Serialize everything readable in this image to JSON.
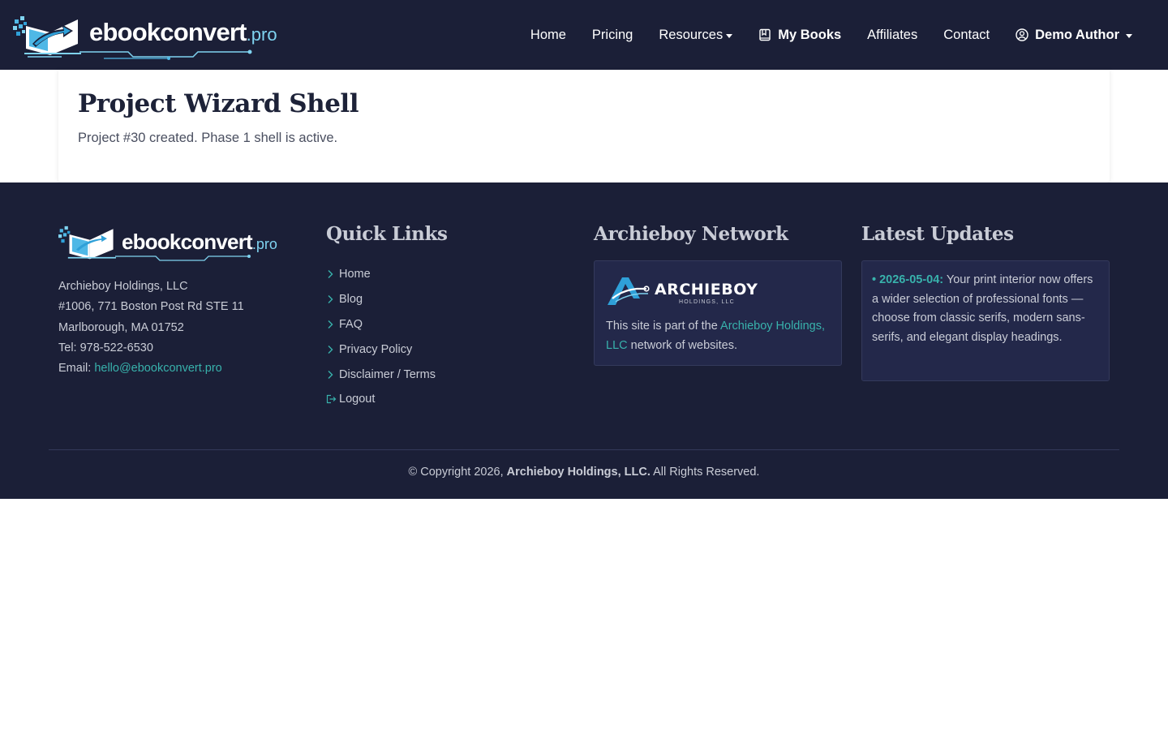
{
  "brand": {
    "name": "ebookconvert",
    "suffix": ".pro"
  },
  "nav": {
    "home": "Home",
    "pricing": "Pricing",
    "resources": "Resources",
    "my_books": "My Books",
    "affiliates": "Affiliates",
    "contact": "Contact",
    "user": "Demo Author"
  },
  "main": {
    "title": "Project Wizard Shell",
    "subtitle": "Project #30 created. Phase 1 shell is active."
  },
  "footer": {
    "address": {
      "company": "Archieboy Holdings, LLC",
      "line1": "#1006, 771 Boston Post Rd STE 11",
      "line2": "Marlborough, MA 01752",
      "tel": "Tel: 978-522-6530",
      "email_label": "Email: ",
      "email": "hello@ebookconvert.pro"
    },
    "quick_links": {
      "heading": "Quick Links",
      "items": [
        "Home",
        "Blog",
        "FAQ",
        "Privacy Policy",
        "Disclaimer / Terms",
        "Logout"
      ]
    },
    "network": {
      "heading": "Archieboy Network",
      "logo_text": "ARCHIEBOY",
      "logo_sub": "HOLDINGS, LLC",
      "text_before": "This site is part of the ",
      "link": "Archieboy Holdings, LLC",
      "text_after": " network of websites."
    },
    "updates": {
      "heading": "Latest Updates",
      "bullet": "•",
      "date": "2026-05-04:",
      "text": " Your print interior now offers a wider selection of professional fonts — choose from classic serifs, modern sans-serifs, and elegant display headings."
    },
    "copyright": {
      "prefix": "© Copyright 2026, ",
      "company": "Archieboy Holdings, LLC.",
      "suffix": " All Rights Reserved."
    }
  },
  "colors": {
    "navy": "#1b1f37",
    "box": "#23284a",
    "teal": "#38b2ac",
    "logo_light_blue": "#7fd3f0"
  }
}
